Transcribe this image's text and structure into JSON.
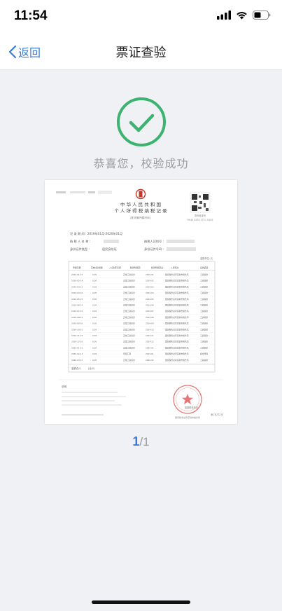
{
  "status_bar": {
    "time": "11:54"
  },
  "nav": {
    "back_label": "返回",
    "title": "票证查验"
  },
  "result": {
    "message": "恭喜您，校验成功"
  },
  "document": {
    "title_line1": "中 华 人 民 共 和 国",
    "title_line2": "个 人 所 得 税 纳 税 记 录",
    "subtitle": "(按 税款所属时间 )",
    "record_period": "记 录 期 间 :  2019年01月-2020年01月",
    "taxpayer_name_label": "纳 税 人 名 称 :",
    "taxpayer_id_label": "纳税人识别号 :",
    "id_type_label": "身份证件类型 :",
    "id_type_value": "居民身份证",
    "id_number_label": "身份证件号码 :",
    "unit_note": "金额单位: 元",
    "columns": [
      "申报日期",
      "实缴(退)税额",
      "入(退)库日期",
      "税款所属期",
      "税款所属期止",
      "入库机关",
      "征收品目"
    ],
    "rows": [
      {
        "date": "2019-01-15",
        "amount": "0.00",
        "tax": "正常工资薪金",
        "period": "2019-01",
        "office": "国家税务总局深圳市税务局",
        "item": "工资薪金"
      },
      {
        "date": "2019-02-14",
        "amount": "0.00",
        "tax": "正常工资薪金",
        "period": "2019-02",
        "office": "国家税务总局深圳市税务局",
        "item": "工资薪金"
      },
      {
        "date": "2019-03-15",
        "amount": "0.00",
        "tax": "正常工资薪金",
        "period": "2019-03",
        "office": "国家税务总局深圳市税务局",
        "item": "工资薪金"
      },
      {
        "date": "2019-04-16",
        "amount": "0.00",
        "tax": "正常工资薪金",
        "period": "2019-04",
        "office": "国家税务总局深圳市税务局",
        "item": "工资薪金"
      },
      {
        "date": "2019-05-15",
        "amount": "0.00",
        "tax": "正常工资薪金",
        "period": "2019-05",
        "office": "国家税务总局深圳市税务局",
        "item": "工资薪金"
      },
      {
        "date": "2019-06-14",
        "amount": "0.00",
        "tax": "正常工资薪金",
        "period": "2019-06",
        "office": "国家税务总局深圳市税务局",
        "item": "工资薪金"
      },
      {
        "date": "2019-07-15",
        "amount": "0.00",
        "tax": "正常工资薪金",
        "period": "2019-07",
        "office": "国家税务总局深圳市税务局",
        "item": "工资薪金"
      },
      {
        "date": "2019-08-15",
        "amount": "0.00",
        "tax": "正常工资薪金",
        "period": "2019-08",
        "office": "国家税务总局深圳市税务局",
        "item": "工资薪金"
      },
      {
        "date": "2019-09-16",
        "amount": "0.00",
        "tax": "正常工资薪金",
        "period": "2019-09",
        "office": "国家税务总局深圳市税务局",
        "item": "工资薪金"
      },
      {
        "date": "2019-10-15",
        "amount": "0.00",
        "tax": "正常工资薪金",
        "period": "2019-10",
        "office": "国家税务总局深圳市税务局",
        "item": "工资薪金"
      },
      {
        "date": "2019-11-15",
        "amount": "0.00",
        "tax": "正常工资薪金",
        "period": "2019-11",
        "office": "国家税务总局深圳市税务局",
        "item": "工资薪金"
      },
      {
        "date": "2019-12-16",
        "amount": "0.00",
        "tax": "正常工资薪金",
        "period": "2019-12",
        "office": "国家税务总局深圳市税务局",
        "item": "工资薪金"
      },
      {
        "date": "2020-01-15",
        "amount": "0.00",
        "tax": "正常工资薪金",
        "period": "2020-01",
        "office": "国家税务总局深圳市税务局",
        "item": "工资薪金"
      },
      {
        "date": "2020-02-14",
        "amount": "0.00",
        "tax": "年度汇算",
        "period": "2019-01",
        "office": "国家税务总局深圳市税务局",
        "item": "综合所得"
      },
      {
        "date": "2020-03-15",
        "amount": "0.00",
        "tax": "正常工资薪金",
        "period": "2020-02",
        "office": "国家税务总局深圳市税务局",
        "item": "工资薪金"
      }
    ],
    "total_label": "金额合计",
    "total_value": "(合计)",
    "notes_label": "说明",
    "verify_label": "查询验证码",
    "verify_code": "RH43 A2S5 5T7C 5Q5S",
    "seal_text": "国家税务总局深圳市税务局",
    "footer_right": "填报税务机关:",
    "page_info": "第1页/共1页"
  },
  "pager": {
    "current": "1",
    "total": "/1"
  }
}
